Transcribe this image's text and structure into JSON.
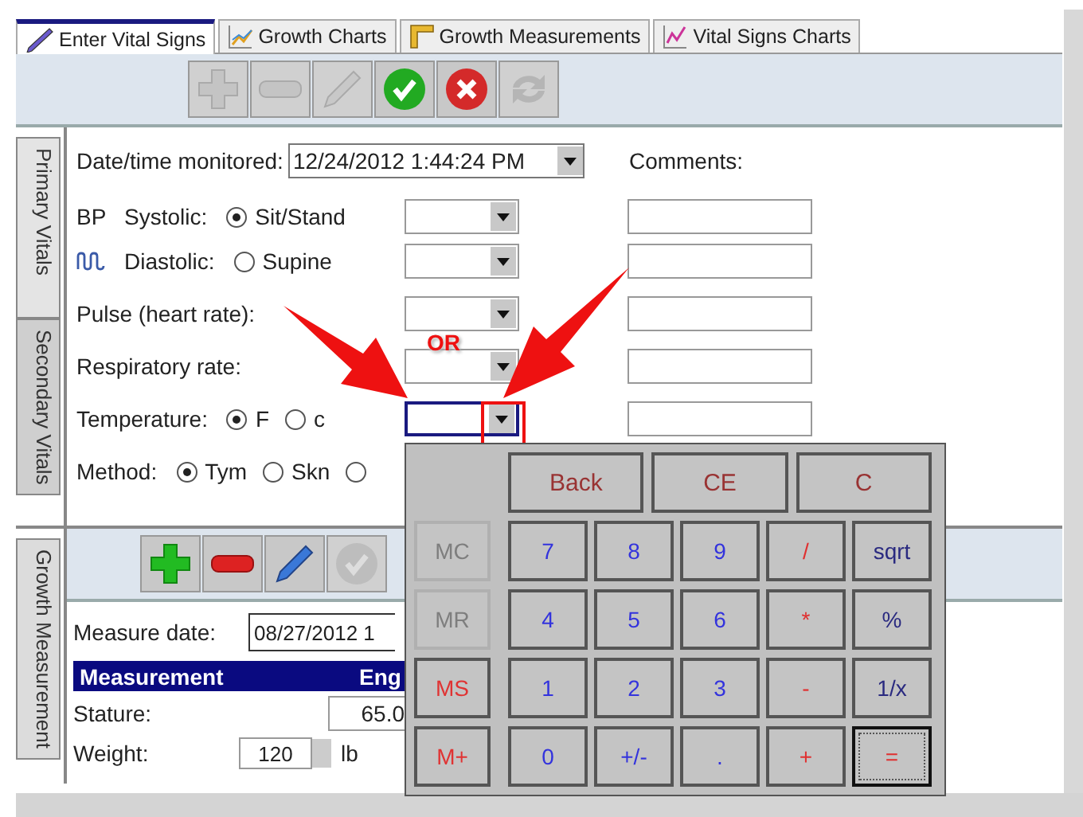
{
  "tabs": [
    {
      "label": "Enter Vital Signs",
      "selected": true
    },
    {
      "label": "Growth Charts",
      "selected": false
    },
    {
      "label": "Growth Measurements",
      "selected": false
    },
    {
      "label": "Vital Signs Charts",
      "selected": false
    }
  ],
  "toolbar": [
    {
      "kind": "add",
      "disabled": true
    },
    {
      "kind": "remove",
      "disabled": true
    },
    {
      "kind": "edit",
      "disabled": true
    },
    {
      "kind": "save",
      "disabled": false
    },
    {
      "kind": "cancel",
      "disabled": false
    },
    {
      "kind": "refresh",
      "disabled": true
    }
  ],
  "side_tabs": [
    {
      "label": "Primary Vitals",
      "selected": true
    },
    {
      "label": "Secondary Vitals",
      "selected": false
    }
  ],
  "vitals": {
    "date_label": "Date/time monitored:",
    "date_value": "12/24/2012 1:44:24 PM",
    "comments_label": "Comments:",
    "rows": [
      {
        "kind": "bp",
        "prefix": "BP",
        "label": "Systolic:",
        "options": [
          {
            "label": "Sit/Stand",
            "selected": true
          }
        ],
        "fields": true,
        "focused": false
      },
      {
        "kind": "bp_icon",
        "label": "Diastolic:",
        "options": [
          {
            "label": "Supine",
            "selected": false
          }
        ],
        "fields": true,
        "focused": false
      },
      {
        "kind": "plain",
        "label": "Pulse (heart rate):",
        "options": [],
        "fields": true,
        "focused": false
      },
      {
        "kind": "plain",
        "label": "Respiratory rate:",
        "options": [],
        "fields": true,
        "focused": false
      },
      {
        "kind": "plain",
        "label": "Temperature:",
        "options": [
          {
            "label": "F",
            "selected": true
          },
          {
            "label": "c",
            "selected": false
          }
        ],
        "fields": true,
        "focused": true
      },
      {
        "kind": "plain",
        "label": "Method:",
        "options": [
          {
            "label": "Tym",
            "selected": true
          },
          {
            "label": "Skn",
            "selected": false
          },
          {
            "selected": false
          }
        ],
        "fields": false
      }
    ]
  },
  "annotation": {
    "label": "OR"
  },
  "growth": {
    "side_tab": {
      "label": "Growth Measurement",
      "selected": true
    },
    "toolbar": [
      {
        "kind": "add",
        "disabled": false
      },
      {
        "kind": "remove",
        "disabled": false
      },
      {
        "kind": "edit",
        "disabled": false
      },
      {
        "kind": "save",
        "disabled": true
      }
    ],
    "date_label": "Measure date:",
    "date_value": "08/27/2012 1",
    "columns": [
      "Measurement",
      "Eng"
    ],
    "rows": [
      {
        "label": "Stature:",
        "value": "65.0"
      },
      {
        "label": "Weight:",
        "value": "120",
        "unit": "lb"
      }
    ]
  },
  "calculator": {
    "top_keys": [
      {
        "label": "Back"
      },
      {
        "label": "CE"
      },
      {
        "label": "C"
      }
    ],
    "keys": [
      {
        "label": "MC",
        "kind": "memory",
        "disabled": true,
        "focused": false
      },
      {
        "label": "7",
        "kind": "digit",
        "disabled": false,
        "focused": false
      },
      {
        "label": "8",
        "kind": "digit",
        "disabled": false,
        "focused": false
      },
      {
        "label": "9",
        "kind": "digit",
        "disabled": false,
        "focused": false
      },
      {
        "label": "/",
        "kind": "operator",
        "disabled": false,
        "focused": false
      },
      {
        "label": "sqrt",
        "kind": "function",
        "disabled": false,
        "focused": false
      },
      {
        "label": "MR",
        "kind": "memory",
        "disabled": true,
        "focused": false
      },
      {
        "label": "4",
        "kind": "digit",
        "disabled": false,
        "focused": false
      },
      {
        "label": "5",
        "kind": "digit",
        "disabled": false,
        "focused": false
      },
      {
        "label": "6",
        "kind": "digit",
        "disabled": false,
        "focused": false
      },
      {
        "label": "*",
        "kind": "operator",
        "disabled": false,
        "focused": false
      },
      {
        "label": "%",
        "kind": "function",
        "disabled": false,
        "focused": false
      },
      {
        "label": "MS",
        "kind": "memory",
        "disabled": false,
        "focused": false
      },
      {
        "label": "1",
        "kind": "digit",
        "disabled": false,
        "focused": false
      },
      {
        "label": "2",
        "kind": "digit",
        "disabled": false,
        "focused": false
      },
      {
        "label": "3",
        "kind": "digit",
        "disabled": false,
        "focused": false
      },
      {
        "label": "-",
        "kind": "operator",
        "disabled": false,
        "focused": false
      },
      {
        "label": "1/x",
        "kind": "function",
        "disabled": false,
        "focused": false
      },
      {
        "label": "M+",
        "kind": "memory",
        "disabled": false,
        "focused": false
      },
      {
        "label": "0",
        "kind": "digit",
        "disabled": false,
        "focused": false
      },
      {
        "label": "+/-",
        "kind": "digit",
        "disabled": false,
        "focused": false
      },
      {
        "label": ".",
        "kind": "digit",
        "disabled": false,
        "focused": false
      },
      {
        "label": "+",
        "kind": "operator",
        "disabled": false,
        "focused": false
      },
      {
        "label": "=",
        "kind": "operator",
        "disabled": false,
        "focused": true
      }
    ]
  }
}
